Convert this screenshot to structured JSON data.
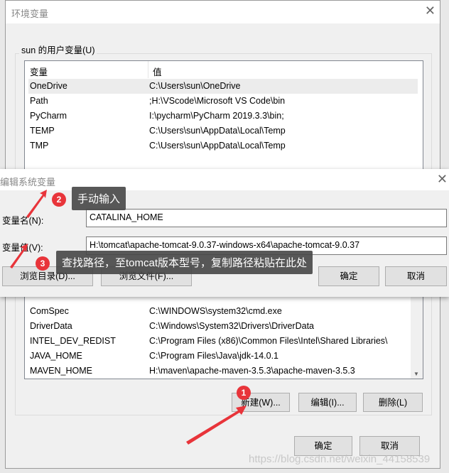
{
  "main_dialog": {
    "title": "环境变量",
    "user_group": "sun 的用户变量(U)",
    "columns": [
      "变量",
      "值"
    ],
    "user_vars": [
      {
        "name": "OneDrive",
        "value": "C:\\Users\\sun\\OneDrive"
      },
      {
        "name": "Path",
        "value": ";H:\\VScode\\Microsoft VS Code\\bin"
      },
      {
        "name": "PyCharm",
        "value": "I:\\pycharm\\PyCharm 2019.3.3\\bin;"
      },
      {
        "name": "TEMP",
        "value": "C:\\Users\\sun\\AppData\\Local\\Temp"
      },
      {
        "name": "TMP",
        "value": "C:\\Users\\sun\\AppData\\Local\\Temp"
      }
    ],
    "system_vars": [
      {
        "name": "ComSpec",
        "value": "C:\\WINDOWS\\system32\\cmd.exe"
      },
      {
        "name": "DriverData",
        "value": "C:\\Windows\\System32\\Drivers\\DriverData"
      },
      {
        "name": "INTEL_DEV_REDIST",
        "value": "C:\\Program Files (x86)\\Common Files\\Intel\\Shared Libraries\\"
      },
      {
        "name": "JAVA_HOME",
        "value": "C:\\Program Files\\Java\\jdk-14.0.1"
      },
      {
        "name": "MAVEN_HOME",
        "value": "H:\\maven\\apache-maven-3.5.3\\apache-maven-3.5.3"
      }
    ],
    "new_button": "新建(W)...",
    "edit_button": "编辑(I)...",
    "delete_button": "删除(L)",
    "ok_button": "确定",
    "cancel_button": "取消"
  },
  "edit_dialog": {
    "title": "编辑系统变量",
    "name_label": "变量名(N):",
    "name_value": "CATALINA_HOME",
    "value_label": "变量值(V):",
    "value_value": "H:\\tomcat\\apache-tomcat-9.0.37-windows-x64\\apache-tomcat-9.0.37",
    "browse_dir": "浏览目录(D)...",
    "browse_file": "浏览文件(F)...",
    "ok": "确定",
    "cancel": "取消"
  },
  "annotations": [
    {
      "number": "1"
    },
    {
      "number": "2",
      "text": "手动输入"
    },
    {
      "number": "3",
      "text": "查找路径，至tomcat版本型号，复制路径粘贴在此处"
    }
  ],
  "annotation_color": "#e8343a",
  "watermark": "https://blog.csdn.net/weixin_44158539"
}
